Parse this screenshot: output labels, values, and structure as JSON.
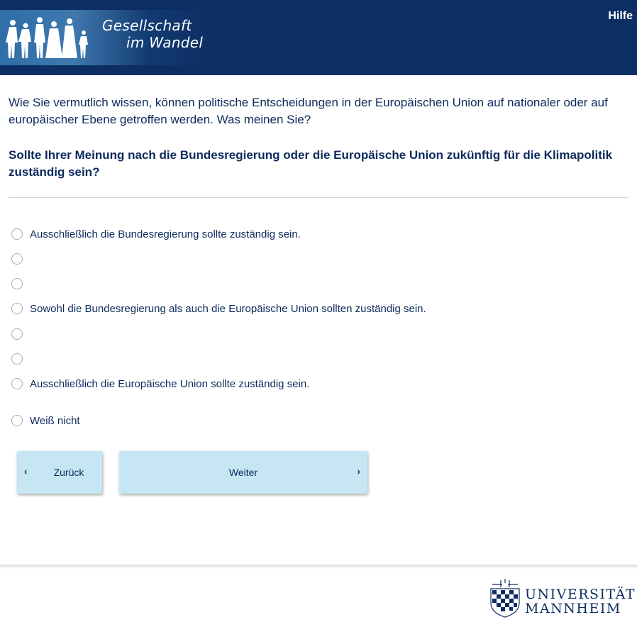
{
  "header": {
    "logo_line1": "Gesellschaft",
    "logo_line2": "im Wandel",
    "help_label": "Hilfe",
    "background_color": "#0d2e63"
  },
  "intro_text": "Wie Sie vermutlich wissen, können politische Entscheidungen in der Europäischen Union auf nationaler oder auf europäischer Ebene getroffen werden. Was meinen Sie?",
  "question_text": "Sollte Ihrer Meinung nach die Bundesregierung oder die Europäische Union zukünftig für die Klimapolitik zuständig sein?",
  "options": [
    {
      "label": "Ausschließlich die Bundesregierung sollte zuständig sein.",
      "selected": false
    },
    {
      "label": "",
      "selected": false
    },
    {
      "label": "",
      "selected": false
    },
    {
      "label": "Sowohl die Bundesregierung als auch die Europäische Union sollten zuständig sein.",
      "selected": false
    },
    {
      "label": "",
      "selected": false
    },
    {
      "label": "",
      "selected": false
    },
    {
      "label": "Ausschließlich die Europäische Union sollte zuständig sein.",
      "selected": false
    },
    {
      "label": "Weiß nicht",
      "selected": false
    }
  ],
  "nav": {
    "back_label": "Zurück",
    "next_label": "Weiter",
    "back_icon": "chevron-left-icon",
    "next_icon": "chevron-right-icon",
    "button_color": "#c6e6f3"
  },
  "footer": {
    "university_line1": "UNIVERSITÄT",
    "university_line2": "MANNHEIM"
  }
}
